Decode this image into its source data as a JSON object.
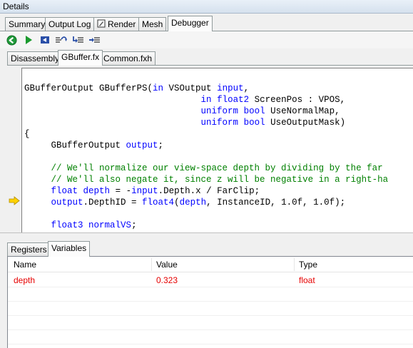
{
  "window": {
    "title": "Details"
  },
  "top_tabs": [
    {
      "label": "Summary"
    },
    {
      "label": "Output Log"
    },
    {
      "label": "Render"
    },
    {
      "label": "Mesh"
    },
    {
      "label": "Debugger"
    }
  ],
  "toolbar": {
    "buttons": [
      {
        "icon": "back-arrow-icon"
      },
      {
        "icon": "play-icon"
      },
      {
        "icon": "step-icon"
      },
      {
        "icon": "step-over-icon"
      },
      {
        "icon": "step-into-icon"
      },
      {
        "icon": "step-out-icon"
      }
    ]
  },
  "file_tabs": [
    {
      "label": "Disassembly"
    },
    {
      "label": "GBuffer.fx"
    },
    {
      "label": "Common.fxh"
    }
  ],
  "code_lines": [
    [
      {
        "t": "GBufferOutput GBufferPS(",
        "c": ""
      },
      {
        "t": "in",
        "c": "kw"
      },
      {
        "t": " VSOutput ",
        "c": ""
      },
      {
        "t": "input",
        "c": "kw"
      },
      {
        "t": ",",
        "c": ""
      }
    ],
    [
      {
        "t": "                                 ",
        "c": ""
      },
      {
        "t": "in",
        "c": "kw"
      },
      {
        "t": " ",
        "c": ""
      },
      {
        "t": "float2",
        "c": "kw"
      },
      {
        "t": " ScreenPos : VPOS,",
        "c": ""
      }
    ],
    [
      {
        "t": "                                 ",
        "c": ""
      },
      {
        "t": "uniform",
        "c": "kw"
      },
      {
        "t": " ",
        "c": ""
      },
      {
        "t": "bool",
        "c": "kw"
      },
      {
        "t": " UseNormalMap,",
        "c": ""
      }
    ],
    [
      {
        "t": "                                 ",
        "c": ""
      },
      {
        "t": "uniform",
        "c": "kw"
      },
      {
        "t": " ",
        "c": ""
      },
      {
        "t": "bool",
        "c": "kw"
      },
      {
        "t": " UseOutputMask)",
        "c": ""
      }
    ],
    [
      {
        "t": "{",
        "c": ""
      }
    ],
    [
      {
        "t": "     GBufferOutput ",
        "c": ""
      },
      {
        "t": "output",
        "c": "kw"
      },
      {
        "t": ";",
        "c": ""
      }
    ],
    [
      {
        "t": "",
        "c": ""
      }
    ],
    [
      {
        "t": "     // We'll normalize our view-space depth by dividing by the far",
        "c": "cm"
      }
    ],
    [
      {
        "t": "     // We'll also negate it, since z will be negative in a right-ha",
        "c": "cm"
      }
    ],
    [
      {
        "t": "     ",
        "c": ""
      },
      {
        "t": "float",
        "c": "kw"
      },
      {
        "t": " ",
        "c": ""
      },
      {
        "t": "depth",
        "c": "kw"
      },
      {
        "t": " = -",
        "c": ""
      },
      {
        "t": "input",
        "c": "kw"
      },
      {
        "t": ".Depth.x / FarClip;",
        "c": ""
      }
    ],
    [
      {
        "t": "     ",
        "c": ""
      },
      {
        "t": "output",
        "c": "kw"
      },
      {
        "t": ".DepthID = ",
        "c": ""
      },
      {
        "t": "float4",
        "c": "kw"
      },
      {
        "t": "(",
        "c": ""
      },
      {
        "t": "depth",
        "c": "kw"
      },
      {
        "t": ", InstanceID, 1.0f, 1.0f);",
        "c": ""
      }
    ],
    [
      {
        "t": "",
        "c": ""
      }
    ],
    [
      {
        "t": "     ",
        "c": ""
      },
      {
        "t": "float3",
        "c": "kw"
      },
      {
        "t": " ",
        "c": ""
      },
      {
        "t": "normalVS",
        "c": "kw"
      },
      {
        "t": ";",
        "c": ""
      }
    ]
  ],
  "bottom_tabs": [
    {
      "label": "Registers"
    },
    {
      "label": "Variables"
    }
  ],
  "variables": {
    "columns": [
      "Name",
      "Value",
      "Type"
    ],
    "rows": [
      {
        "name": "depth",
        "value": "0.323",
        "type": "float"
      }
    ]
  },
  "colors": {
    "keyword": "#0000ff",
    "comment": "#008000",
    "changed_value": "#e60000",
    "current_line_arrow": "#ffd200"
  }
}
